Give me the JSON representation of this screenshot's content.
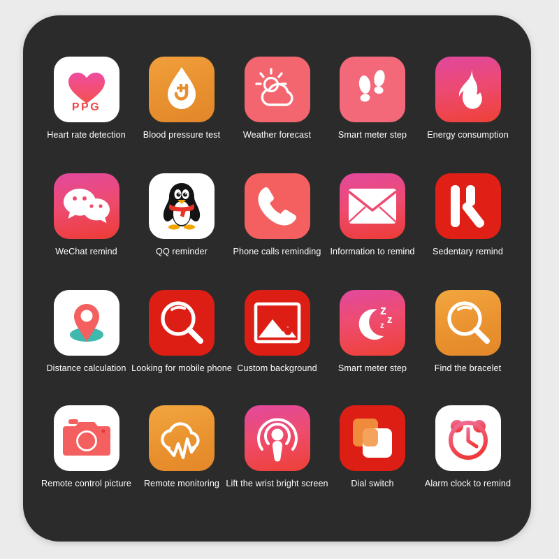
{
  "window": {
    "background_color": "#ebebeb",
    "panel_color": "#2b2b2b",
    "title": "Smart bracelet function icon grid"
  },
  "grid": {
    "columns": 5,
    "rows": 4,
    "rows_data": [
      [
        {
          "label": "Heart rate detection",
          "icon": "heart-ppg-icon",
          "tile_style": "bg-white",
          "accent": "#ef4260"
        },
        {
          "label": "Blood pressure test",
          "icon": "blood-drop-plus-icon",
          "tile_style": "bg-orange",
          "accent": "#ffffff"
        },
        {
          "label": "Weather forecast",
          "icon": "sun-cloud-icon",
          "tile_style": "bg-pinkflat",
          "accent": "#ffffff"
        },
        {
          "label": "Smart meter step",
          "icon": "footsteps-icon",
          "tile_style": "bg-pinkflat2",
          "accent": "#ffffff"
        },
        {
          "label": "Energy consumption",
          "icon": "flame-icon",
          "tile_style": "bg-magred",
          "accent": "#ffffff"
        }
      ],
      [
        {
          "label": "WeChat remind",
          "icon": "wechat-bubbles-icon",
          "tile_style": "bg-magred2",
          "accent": "#ffffff"
        },
        {
          "label": "QQ reminder",
          "icon": "qq-penguin-icon",
          "tile_style": "bg-white",
          "accent": "#1a1a1a"
        },
        {
          "label": "Phone calls reminding",
          "icon": "phone-handset-icon",
          "tile_style": "bg-coral",
          "accent": "#ffffff"
        },
        {
          "label": "Information to remind",
          "icon": "envelope-icon",
          "tile_style": "bg-magred2",
          "accent": "#ffffff"
        },
        {
          "label": "Sedentary remind",
          "icon": "sitting-person-bars-icon",
          "tile_style": "bg-red",
          "accent": "#ffffff"
        }
      ],
      [
        {
          "label": "Distance calculation",
          "icon": "map-pin-icon",
          "tile_style": "bg-white",
          "accent": "#f4605f"
        },
        {
          "label": "Looking for mobile phone",
          "icon": "magnifier-icon",
          "tile_style": "bg-red2",
          "accent": "#ffffff"
        },
        {
          "label": "Custom background",
          "icon": "photo-picture-icon",
          "tile_style": "bg-red2",
          "accent": "#ffffff"
        },
        {
          "label": "Smart meter step",
          "icon": "moon-zzz-icon",
          "tile_style": "bg-magred3",
          "accent": "#ffffff"
        },
        {
          "label": "Find the bracelet",
          "icon": "magnifier-icon",
          "tile_style": "bg-orange2",
          "accent": "#ffffff"
        }
      ],
      [
        {
          "label": "Remote control picture",
          "icon": "camera-icon",
          "tile_style": "bg-white",
          "accent": "#f4605f"
        },
        {
          "label": "Remote monitoring",
          "icon": "cloud-pulse-icon",
          "tile_style": "bg-orange2",
          "accent": "#ffffff"
        },
        {
          "label": "Lift the wrist bright screen",
          "icon": "podcast-waves-icon",
          "tile_style": "bg-magred3",
          "accent": "#ffffff"
        },
        {
          "label": "Dial switch",
          "icon": "stacked-squares-icon",
          "tile_style": "bg-red2",
          "accent": "#f2a356"
        },
        {
          "label": "Alarm clock to remind",
          "icon": "alarm-clock-icon",
          "tile_style": "bg-white",
          "accent": "#ef4060"
        }
      ]
    ]
  },
  "icon_badge_text": {
    "ppg": "PPG",
    "z_big": "z",
    "z_small": "z"
  }
}
